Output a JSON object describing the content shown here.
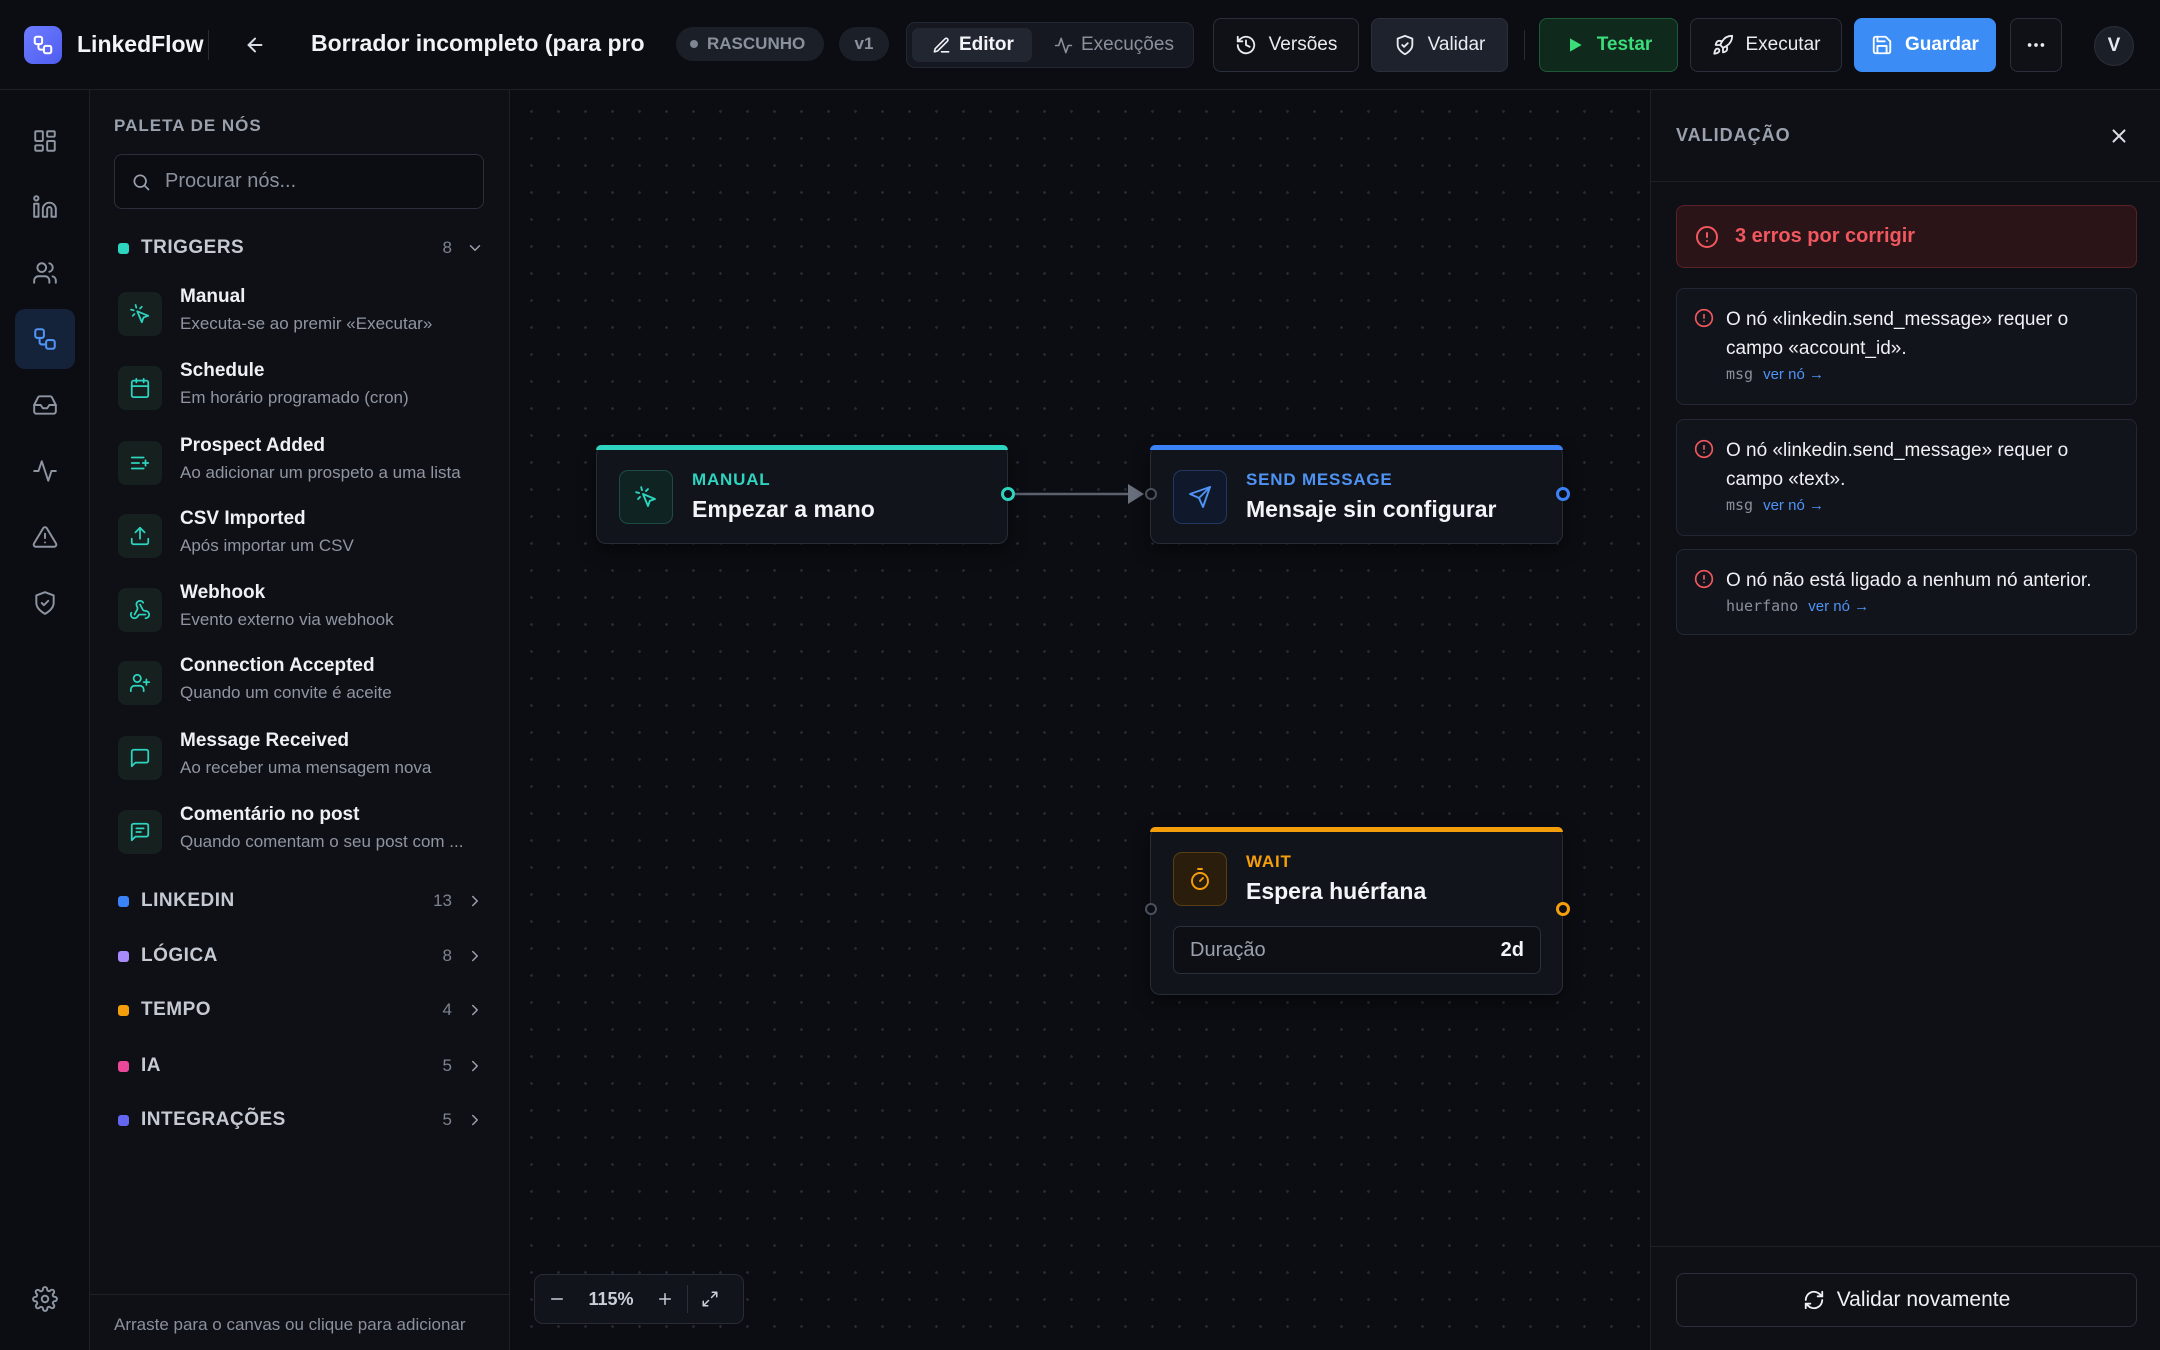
{
  "app": {
    "name": "LinkedFlow"
  },
  "header": {
    "flow_title": "Borrador incompleto (para probar validación)",
    "status_badge": "RASCUNHO",
    "version_badge": "v1",
    "tabs": [
      {
        "label": "Editor",
        "active": true
      },
      {
        "label": "Execuções",
        "active": false
      }
    ],
    "buttons": {
      "versions": "Versões",
      "validate": "Validar",
      "test": "Testar",
      "execute": "Executar",
      "save": "Guardar"
    },
    "avatar_initial": "V"
  },
  "palette": {
    "title": "PALETA DE NÓS",
    "search_placeholder": "Procurar nós...",
    "categories": [
      {
        "name": "TRIGGERS",
        "count": "8",
        "color": "#2dd4bf",
        "expanded": true
      },
      {
        "name": "LINKEDIN",
        "count": "13",
        "color": "#3b82f6",
        "expanded": false
      },
      {
        "name": "LÓGICA",
        "count": "8",
        "color": "#a78bfa",
        "expanded": false
      },
      {
        "name": "TEMPO",
        "count": "4",
        "color": "#f59e0b",
        "expanded": false
      },
      {
        "name": "IA",
        "count": "5",
        "color": "#ec4899",
        "expanded": false
      },
      {
        "name": "INTEGRAÇÕES",
        "count": "5",
        "color": "#6366f1",
        "expanded": false
      }
    ],
    "trigger_items": [
      {
        "title": "Manual",
        "desc": "Executa-se ao premir «Executar»",
        "icon": "pointer-click-icon"
      },
      {
        "title": "Schedule",
        "desc": "Em horário programado (cron)",
        "icon": "calendar-icon"
      },
      {
        "title": "Prospect Added",
        "desc": "Ao adicionar um prospeto a uma lista",
        "icon": "list-plus-icon"
      },
      {
        "title": "CSV Imported",
        "desc": "Após importar um CSV",
        "icon": "upload-icon"
      },
      {
        "title": "Webhook",
        "desc": "Evento externo via webhook",
        "icon": "webhook-icon"
      },
      {
        "title": "Connection Accepted",
        "desc": "Quando um convite é aceite",
        "icon": "user-plus-icon"
      },
      {
        "title": "Message Received",
        "desc": "Ao receber uma mensagem nova",
        "icon": "message-icon"
      },
      {
        "title": "Comentário no post",
        "desc": "Quando comentam o seu post com ...",
        "icon": "comment-icon"
      }
    ],
    "footer_hint": "Arraste para o canvas ou clique para adicionar"
  },
  "canvas": {
    "nodes": {
      "manual": {
        "type": "MANUAL",
        "name": "Empezar a mano",
        "color": "#2dd4bf"
      },
      "send_message": {
        "type": "SEND MESSAGE",
        "name": "Mensaje sin configurar",
        "color": "#3b82f6"
      },
      "wait": {
        "type": "WAIT",
        "name": "Espera huérfana",
        "color": "#f59e0b",
        "field_label": "Duração",
        "field_value": "2d"
      }
    },
    "zoom_level": "115%"
  },
  "validation": {
    "title": "VALIDAÇÃO",
    "summary": "3 erros por corrigir",
    "errors": [
      {
        "message": "O nó «linkedin.send_message» requer o campo «account_id».",
        "code": "msg",
        "link": "ver nó →"
      },
      {
        "message": "O nó «linkedin.send_message» requer o campo «text».",
        "code": "msg",
        "link": "ver nó →"
      },
      {
        "message": "O nó não está ligado a nenhum nó anterior.",
        "code": "huerfano",
        "link": "ver nó →"
      }
    ],
    "revalidate_button": "Validar novamente",
    "error_color": "#ef4444"
  }
}
